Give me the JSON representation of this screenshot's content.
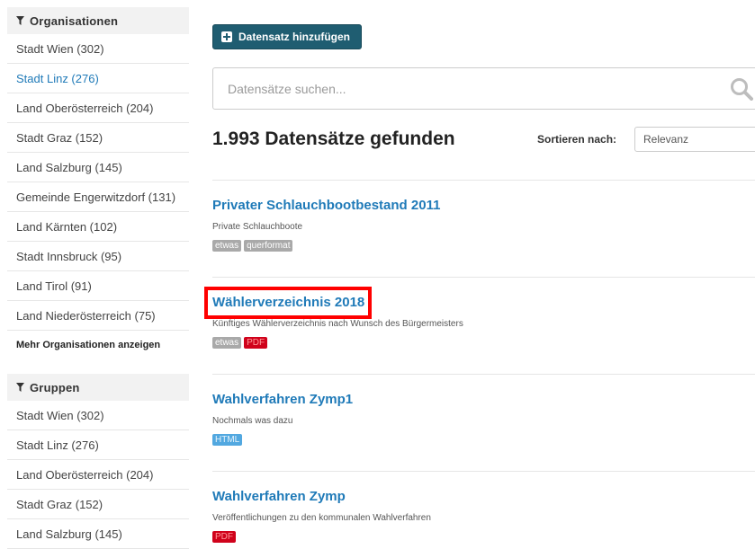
{
  "sidebar": {
    "organisations": {
      "title": "Organisationen",
      "items": [
        {
          "label": "Stadt Wien (302)"
        },
        {
          "label": "Stadt Linz (276)"
        },
        {
          "label": "Land Oberösterreich (204)"
        },
        {
          "label": "Stadt Graz (152)"
        },
        {
          "label": "Land Salzburg (145)"
        },
        {
          "label": "Gemeinde Engerwitzdorf (131)"
        },
        {
          "label": "Land Kärnten (102)"
        },
        {
          "label": "Stadt Innsbruck (95)"
        },
        {
          "label": "Land Tirol (91)"
        },
        {
          "label": "Land Niederösterreich (75)"
        }
      ],
      "more_label": "Mehr Organisationen anzeigen"
    },
    "groups": {
      "title": "Gruppen",
      "items": [
        {
          "label": "Stadt Wien (302)"
        },
        {
          "label": "Stadt Linz (276)"
        },
        {
          "label": "Land Oberösterreich (204)"
        },
        {
          "label": "Stadt Graz (152)"
        },
        {
          "label": "Land Salzburg (145)"
        }
      ]
    }
  },
  "toolbar": {
    "add_label": "Datensatz hinzufügen"
  },
  "search": {
    "placeholder": "Datensätze suchen..."
  },
  "results": {
    "count_label": "1.993 Datensätze gefunden",
    "sort_label": "Sortieren nach:",
    "sort_value": "Relevanz"
  },
  "datasets": [
    {
      "title": "Privater Schlauchbootbestand 2011",
      "notes": "Private Schlauchboote",
      "tags": [
        "etwas",
        "querformat"
      ]
    },
    {
      "title": "Wählerverzeichnis 2018",
      "notes": "Künftiges Wählerverzeichnis nach Wunsch des Bürgermeisters",
      "tags": [
        "etwas",
        "PDF"
      ]
    },
    {
      "title": "Wahlverfahren Zymp1",
      "notes": "Nochmals was dazu",
      "tags": [
        "HTML"
      ]
    },
    {
      "title": "Wahlverfahren Zymp",
      "notes": "Veröffentlichungen zu den kommunalen Wahlverfahren",
      "tags": [
        "PDF"
      ]
    }
  ],
  "colors": {
    "link": "#1f7ab8",
    "button": "#1f5d71",
    "highlight": "#ff0000",
    "tag_grey": "#a9a9a9",
    "tag_red": "#d0021b",
    "tag_blue": "#52a8e0"
  },
  "icons": {
    "filter": "filter-icon",
    "search": "search-icon",
    "add": "plus-icon"
  }
}
